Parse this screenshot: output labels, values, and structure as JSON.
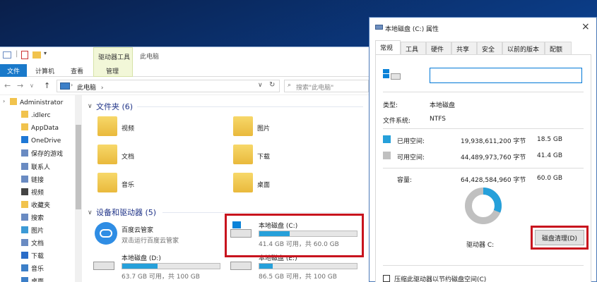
{
  "explorer": {
    "context_tab": "驱动器工具",
    "title": "此电脑",
    "ribbon": {
      "file": "文件",
      "computer": "计算机",
      "view": "查看",
      "manage": "管理"
    },
    "address": "此电脑",
    "search_placeholder": "搜索\"此电脑\"",
    "nav": [
      "Administrator",
      ".idlerc",
      "AppData",
      "OneDrive",
      "保存的游戏",
      "联系人",
      "链接",
      "视频",
      "收藏夹",
      "搜索",
      "图片",
      "文档",
      "下载",
      "音乐",
      "桌面"
    ],
    "folders_header": "文件夹 (6)",
    "folders": [
      "视频",
      "图片",
      "文档",
      "下载",
      "音乐",
      "桌面"
    ],
    "devices_header": "设备和驱动器 (5)",
    "baidu": {
      "name": "百度云管家",
      "desc": "双击运行百度云管家"
    },
    "drives": [
      {
        "name": "本地磁盘 (C:)",
        "free": "41.4 GB 可用，共 60.0 GB",
        "used_fraction": 0.31
      },
      {
        "name": "本地磁盘 (D:)",
        "free": "63.7 GB 可用，共 100 GB",
        "used_fraction": 0.36
      },
      {
        "name": "本地磁盘 (E:)",
        "free": "86.5 GB 可用，共 100 GB",
        "used_fraction": 0.14
      }
    ]
  },
  "dialog": {
    "title": "本地磁盘 (C:) 属性",
    "close": "×",
    "tabs": [
      "常规",
      "工具",
      "硬件",
      "共享",
      "安全",
      "以前的版本",
      "配额"
    ],
    "name_value": "",
    "type_label": "类型:",
    "type_value": "本地磁盘",
    "fs_label": "文件系统:",
    "fs_value": "NTFS",
    "used_label": "已用空间:",
    "used_bytes": "19,938,611,200 字节",
    "used_gb": "18.5 GB",
    "free_label": "可用空间:",
    "free_bytes": "44,489,973,760 字节",
    "free_gb": "41.4 GB",
    "cap_label": "容量:",
    "cap_bytes": "64,428,584,960 字节",
    "cap_gb": "60.0 GB",
    "drive_label": "驱动器 C:",
    "cleanup": "磁盘清理(D)",
    "compress": "压缩此驱动器以节约磁盘空间(C)",
    "used_fraction": 0.31,
    "colors": {
      "used": "#26a0da",
      "free": "#c0c0c0",
      "highlight": "#c8141e"
    }
  }
}
